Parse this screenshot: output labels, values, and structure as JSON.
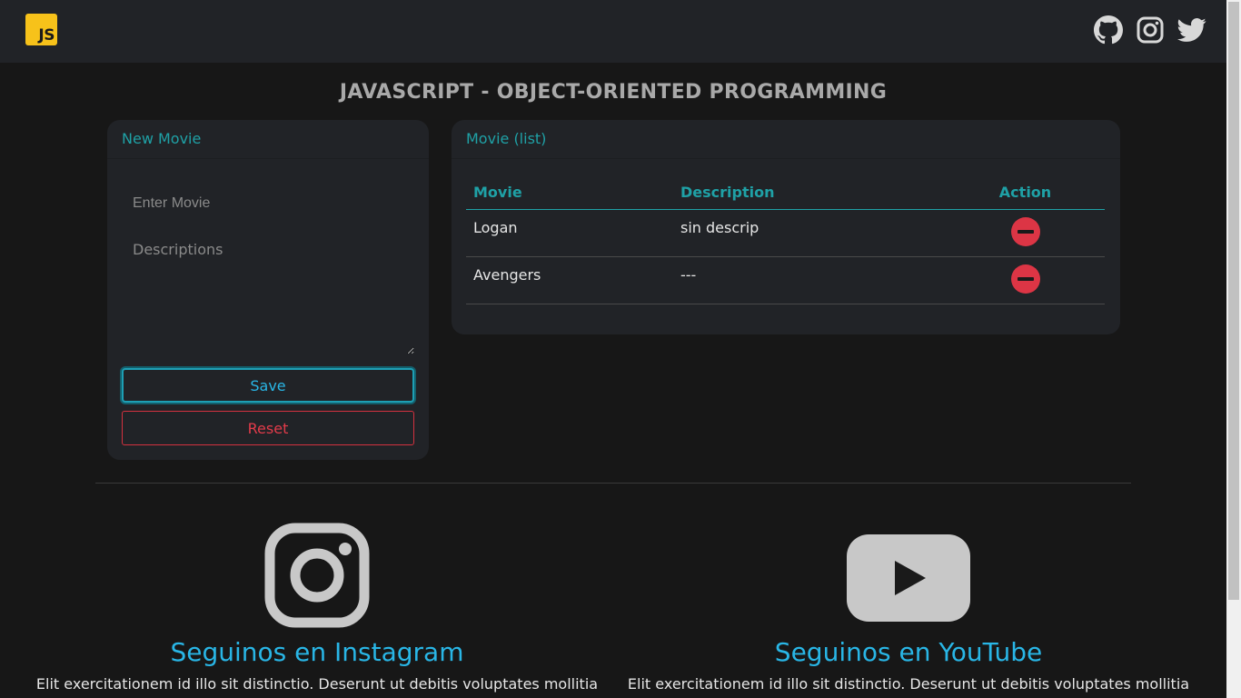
{
  "navbar": {
    "logo_text": "JS",
    "social_icons": [
      "github-icon",
      "instagram-icon",
      "twitter-icon"
    ]
  },
  "title": "JAVASCRIPT - OBJECT-ORIENTED PROGRAMMING",
  "form": {
    "header": "New Movie",
    "movie_placeholder": "Enter Movie",
    "description_placeholder": "Descriptions",
    "save_label": "Save",
    "reset_label": "Reset"
  },
  "list": {
    "header": "Movie (list)",
    "columns": [
      "Movie",
      "Description",
      "Action"
    ],
    "rows": [
      {
        "movie": "Logan",
        "description": "sin descrip"
      },
      {
        "movie": "Avengers",
        "description": "---"
      }
    ]
  },
  "follow": {
    "instagram": {
      "title": "Seguinos en Instagram",
      "text": "Elit exercitationem id illo sit distinctio. Deserunt ut debitis voluptates mollitia"
    },
    "youtube": {
      "title": "Seguinos en YouTube",
      "text": "Elit exercitationem id illo sit distinctio. Deserunt ut debitis voluptates mollitia"
    }
  },
  "colors": {
    "accent": "#1fa1a6",
    "link_blue": "#29b6e6",
    "danger": "#dc3545",
    "logo_yellow": "#f7c21a"
  }
}
